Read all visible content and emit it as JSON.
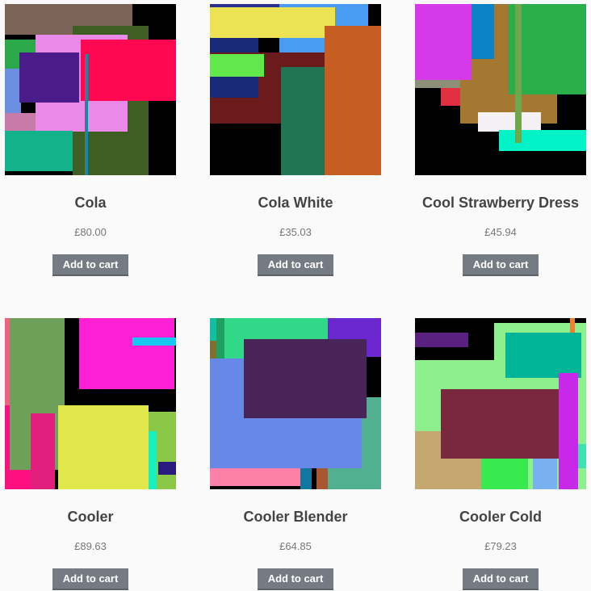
{
  "products": [
    {
      "name": "Cola",
      "price": "£80.00",
      "button": "Add to cart",
      "thumb_bg": "#000000"
    },
    {
      "name": "Cola White",
      "price": "£35.03",
      "button": "Add to cart",
      "thumb_bg": "#000000"
    },
    {
      "name": "Cool Strawberry Dress",
      "price": "£45.94",
      "button": "Add to cart",
      "thumb_bg": "#000000"
    },
    {
      "name": "Cooler",
      "price": "£89.63",
      "button": "Add to cart",
      "thumb_bg": "#000000"
    },
    {
      "name": "Cooler Blender",
      "price": "£64.85",
      "button": "Add to cart",
      "thumb_bg": "#000000"
    },
    {
      "name": "Cooler Cold",
      "price": "£79.23",
      "button": "Add to cart",
      "thumb_bg": "#000000"
    }
  ],
  "colors": {
    "page_bg": "#fafafa",
    "title": "#444444",
    "price": "#777777",
    "button_bg": "#747b82",
    "button_text": "#ffffff"
  }
}
